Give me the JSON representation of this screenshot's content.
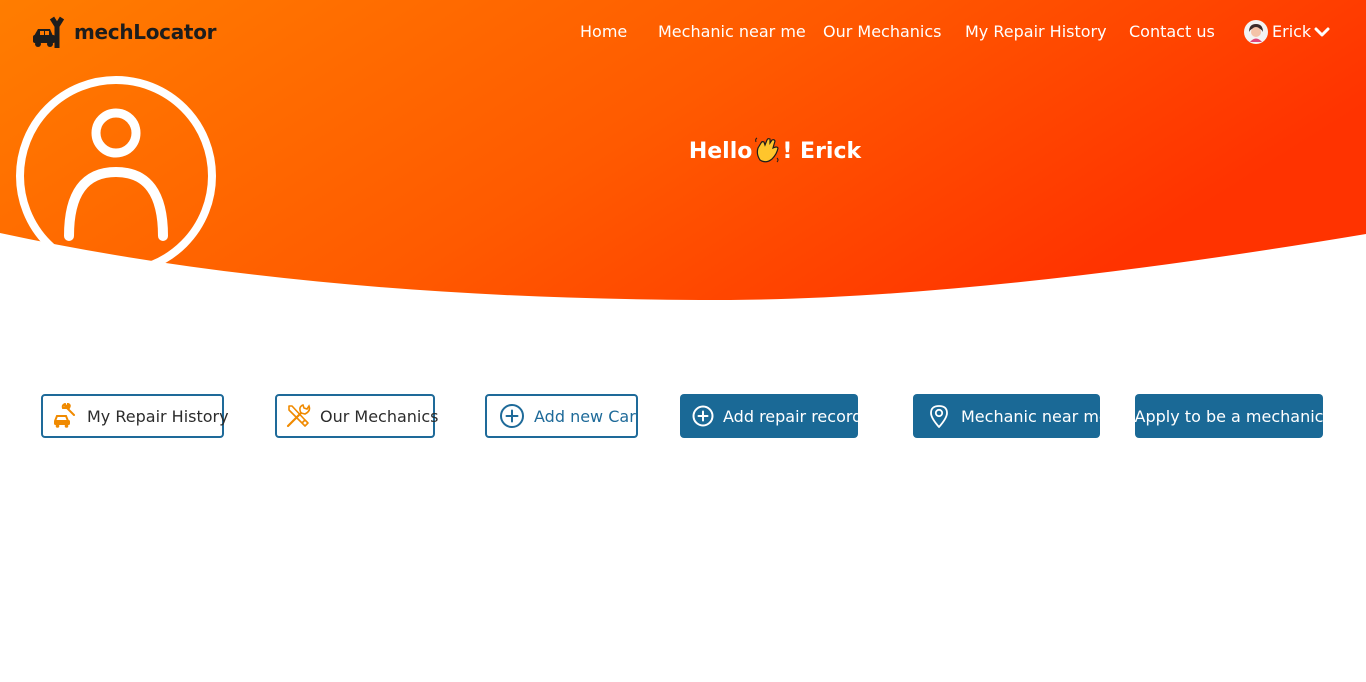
{
  "brand": {
    "name": "mechLocator",
    "logo_icon": "mechanic-car-logo-icon"
  },
  "nav": {
    "links": [
      {
        "label": "Home"
      },
      {
        "label": "Mechanic near me"
      },
      {
        "label": "Our Mechanics"
      },
      {
        "label": "My Repair History"
      },
      {
        "label": "Contact us"
      }
    ],
    "user": {
      "name": "Erick",
      "avatar_icon": "user-avatar-icon",
      "caret_icon": "chevron-down-icon"
    }
  },
  "hero": {
    "greeting_prefix": "Hello",
    "greeting_suffix": "! Erick",
    "wave_icon": "waving-hand-icon",
    "profile_icon": "profile-placeholder-icon"
  },
  "actions": [
    {
      "label": "My Repair History",
      "icon": "car-repair-icon",
      "style": "outline"
    },
    {
      "label": "Our Mechanics",
      "icon": "tools-icon",
      "style": "outline"
    },
    {
      "label": "Add new Car",
      "icon": "plus-circle-icon",
      "style": "outline-blue"
    },
    {
      "label": "Add repair record",
      "icon": "plus-circle-icon",
      "style": "solid"
    },
    {
      "label": "Mechanic near me",
      "icon": "location-pin-icon",
      "style": "solid"
    },
    {
      "label": "Apply to be a mechanic",
      "icon": "",
      "style": "solid"
    }
  ],
  "colors": {
    "hero_gradient_start": "#ff7b00",
    "hero_gradient_end": "#ff3800",
    "accent_blue": "#1a6996",
    "icon_orange": "#f08a00"
  }
}
